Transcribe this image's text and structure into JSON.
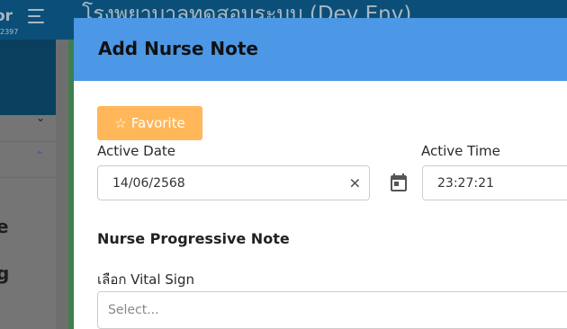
{
  "background": {
    "brand": "or",
    "version": "2397",
    "hospital_title": "โรงพยาบาลทดสอบระบบ (Dev Env)",
    "sidebar_text_1": "e",
    "sidebar_text_2": "g"
  },
  "modal": {
    "title": "Add Nurse Note",
    "favorite_button": "Favorite",
    "active_date": {
      "label": "Active Date",
      "value": "14/06/2568"
    },
    "active_time": {
      "label": "Active Time",
      "value": "23:27:21"
    },
    "section_title": "Nurse Progressive Note",
    "vital_sign": {
      "label": "เลือก Vital Sign",
      "placeholder": "Select..."
    }
  },
  "colors": {
    "header": "#4c97e6",
    "favorite": "#ffb75a",
    "topbar": "#0b4f79"
  },
  "icons": {
    "favorite": "star-outline-icon",
    "clear": "close-icon",
    "date_picker": "calendar-icon",
    "menu": "hamburger-icon"
  }
}
